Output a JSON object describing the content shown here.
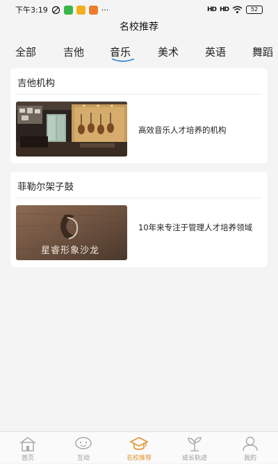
{
  "status_bar": {
    "time": "下午3:19",
    "signal1": "HD",
    "signal2": "HD",
    "battery": "52",
    "more": "···"
  },
  "header": {
    "title": "名校推荐"
  },
  "tabs": [
    {
      "label": "全部"
    },
    {
      "label": "吉他"
    },
    {
      "label": "音乐",
      "active": true
    },
    {
      "label": "美术"
    },
    {
      "label": "英语"
    },
    {
      "label": "舞蹈"
    }
  ],
  "cards": [
    {
      "title": "吉他机构",
      "description": "高效音乐人才培养的机构",
      "image_icon": "guitar-studio-photo"
    },
    {
      "title": "菲勒尔架子鼓",
      "description": "10年来专注于管理人才培养领域",
      "image_icon": "salon-logo-photo",
      "image_text": "星睿形象沙龙"
    }
  ],
  "bottom_nav": [
    {
      "label": "首页",
      "icon": "home-icon"
    },
    {
      "label": "互动",
      "icon": "chat-icon"
    },
    {
      "label": "名校推荐",
      "icon": "graduation-cap-icon",
      "active": true
    },
    {
      "label": "成长轨迹",
      "icon": "sprout-icon"
    },
    {
      "label": "我的",
      "icon": "profile-icon"
    }
  ],
  "colors": {
    "accent": "#e0922f",
    "tab_underline": "#4a90d9",
    "background": "#f4f4f4"
  }
}
